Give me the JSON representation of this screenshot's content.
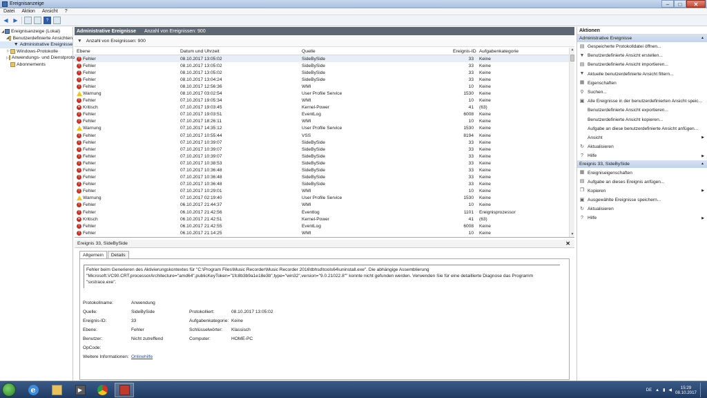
{
  "window": {
    "title": "Ereignisanzeige"
  },
  "menu": [
    "Datei",
    "Aktion",
    "Ansicht",
    "?"
  ],
  "tree": [
    {
      "label": "Ereignisanzeige (Lokal)",
      "level": 0,
      "icon": "computer-icon"
    },
    {
      "label": "Benutzerdefinierte Ansichten",
      "level": 1,
      "icon": "folder-icon"
    },
    {
      "label": "Administrative Ereignisse",
      "level": 2,
      "icon": "filter-icon",
      "selected": true
    },
    {
      "label": "Windows-Protokolle",
      "level": 1,
      "icon": "folder-icon"
    },
    {
      "label": "Anwendungs- und Dienstprotokolle",
      "level": 1,
      "icon": "folder-icon"
    },
    {
      "label": "Abonnements",
      "level": 1,
      "icon": "subscription-icon"
    }
  ],
  "center": {
    "title": "Administrative Ereignisse",
    "count_label": "Anzahl von Ereignissen: 900",
    "filter_label": "Anzahl von Ereignissen: 900",
    "columns": {
      "level": "Ebene",
      "date": "Datum und Uhrzeit",
      "source": "Quelle",
      "id": "Ereignis-ID",
      "category": "Aufgabenkategorie"
    }
  },
  "events": [
    {
      "type": "err",
      "level": "Fehler",
      "date": "08.10.2017 13:05:02",
      "source": "SideBySide",
      "id": "33",
      "cat": "Keine"
    },
    {
      "type": "err",
      "level": "Fehler",
      "date": "08.10.2017 13:05:02",
      "source": "SideBySide",
      "id": "33",
      "cat": "Keine"
    },
    {
      "type": "err",
      "level": "Fehler",
      "date": "08.10.2017 13:05:02",
      "source": "SideBySide",
      "id": "33",
      "cat": "Keine"
    },
    {
      "type": "err",
      "level": "Fehler",
      "date": "08.10.2017 13:04:24",
      "source": "SideBySide",
      "id": "33",
      "cat": "Keine"
    },
    {
      "type": "err",
      "level": "Fehler",
      "date": "08.10.2017 12:56:36",
      "source": "WMI",
      "id": "10",
      "cat": "Keine"
    },
    {
      "type": "warn",
      "level": "Warnung",
      "date": "08.10.2017 03:02:54",
      "source": "User Profile Service",
      "id": "1530",
      "cat": "Keine"
    },
    {
      "type": "err",
      "level": "Fehler",
      "date": "07.10.2017 19:05:34",
      "source": "WMI",
      "id": "10",
      "cat": "Keine"
    },
    {
      "type": "crit",
      "level": "Kritisch",
      "date": "07.10.2017 19:03:45",
      "source": "Kernel-Power",
      "id": "41",
      "cat": "(63)"
    },
    {
      "type": "err",
      "level": "Fehler",
      "date": "07.10.2017 19:03:51",
      "source": "EventLog",
      "id": "6008",
      "cat": "Keine"
    },
    {
      "type": "err",
      "level": "Fehler",
      "date": "07.10.2017 18:26:11",
      "source": "WMI",
      "id": "10",
      "cat": "Keine"
    },
    {
      "type": "warn",
      "level": "Warnung",
      "date": "07.10.2017 14:35:12",
      "source": "User Profile Service",
      "id": "1530",
      "cat": "Keine"
    },
    {
      "type": "err",
      "level": "Fehler",
      "date": "07.10.2017 10:55:44",
      "source": "VSS",
      "id": "8194",
      "cat": "Keine"
    },
    {
      "type": "err",
      "level": "Fehler",
      "date": "07.10.2017 10:39:07",
      "source": "SideBySide",
      "id": "33",
      "cat": "Keine"
    },
    {
      "type": "err",
      "level": "Fehler",
      "date": "07.10.2017 10:39:07",
      "source": "SideBySide",
      "id": "33",
      "cat": "Keine"
    },
    {
      "type": "err",
      "level": "Fehler",
      "date": "07.10.2017 10:39:07",
      "source": "SideBySide",
      "id": "33",
      "cat": "Keine"
    },
    {
      "type": "err",
      "level": "Fehler",
      "date": "07.10.2017 10:38:53",
      "source": "SideBySide",
      "id": "33",
      "cat": "Keine"
    },
    {
      "type": "err",
      "level": "Fehler",
      "date": "07.10.2017 10:36:48",
      "source": "SideBySide",
      "id": "33",
      "cat": "Keine"
    },
    {
      "type": "err",
      "level": "Fehler",
      "date": "07.10.2017 10:36:48",
      "source": "SideBySide",
      "id": "33",
      "cat": "Keine"
    },
    {
      "type": "err",
      "level": "Fehler",
      "date": "07.10.2017 10:36:48",
      "source": "SideBySide",
      "id": "33",
      "cat": "Keine"
    },
    {
      "type": "err",
      "level": "Fehler",
      "date": "07.10.2017 10:29:01",
      "source": "WMI",
      "id": "10",
      "cat": "Keine"
    },
    {
      "type": "warn",
      "level": "Warnung",
      "date": "07.10.2017 02:19:40",
      "source": "User Profile Service",
      "id": "1530",
      "cat": "Keine"
    },
    {
      "type": "err",
      "level": "Fehler",
      "date": "06.10.2017 21:44:37",
      "source": "WMI",
      "id": "10",
      "cat": "Keine"
    },
    {
      "type": "err",
      "level": "Fehler",
      "date": "06.10.2017 21:42:56",
      "source": "Eventlog",
      "id": "1101",
      "cat": "Ereignisprozessor"
    },
    {
      "type": "crit",
      "level": "Kritisch",
      "date": "06.10.2017 21:42:51",
      "source": "Kernel-Power",
      "id": "41",
      "cat": "(63)"
    },
    {
      "type": "err",
      "level": "Fehler",
      "date": "06.10.2017 21:42:55",
      "source": "EventLog",
      "id": "6008",
      "cat": "Keine"
    },
    {
      "type": "err",
      "level": "Fehler",
      "date": "06.10.2017 21:14:25",
      "source": "WMI",
      "id": "10",
      "cat": "Keine"
    }
  ],
  "detail": {
    "header": "Ereignis 33, SideBySide",
    "tabs": [
      "Allgemein",
      "Details"
    ],
    "message_line1": "Fehler beim Generieren des Aktivierungskontextes für \"C:\\Program Files\\Music Recorder\\Music Recorder 2016\\tbhsd\\tools64\\uninstall.exe\". Die abhängige Assemblierung",
    "message_line2": "\"Microsoft.VC90.CRT,processorArchitecture=\"amd64\",publicKeyToken=\"1fc8b3b9a1e18e3b\",type=\"win32\",version=\"9.0.21022.8\"\" konnte nicht gefunden werden. Verwenden Sie für eine detaillierte Diagnose das Programm \"sxstrace.exe\".",
    "labels": {
      "log": "Protokollname:",
      "source": "Quelle:",
      "id": "Ereignis-ID:",
      "level": "Ebene:",
      "user": "Benutzer:",
      "opcode": "OpCode:",
      "more": "Weitere Informationen:",
      "logged": "Protokolliert:",
      "category": "Aufgabenkategorie:",
      "keywords": "Schlüsselwörter:",
      "computer": "Computer:"
    },
    "values": {
      "log": "Anwendung",
      "source": "SideBySide",
      "id": "33",
      "level": "Fehler",
      "user": "Nicht zutreffend",
      "more": "Onlinehilfe",
      "logged": "08.10.2017 13:05:02",
      "category": "Keine",
      "keywords": "Klassisch",
      "computer": "HOME-PC"
    }
  },
  "actions": {
    "header": "Aktionen",
    "section1": "Administrative Ereignisse",
    "items1": [
      {
        "label": "Gespeicherte Protokolldatei öffnen...",
        "icon": "open-log-icon"
      },
      {
        "label": "Benutzerdefinierte Ansicht erstellen...",
        "icon": "create-view-icon"
      },
      {
        "label": "Benutzerdefinierte Ansicht importieren...",
        "icon": "import-view-icon"
      },
      {
        "label": "Aktuelle benutzerdefinierte Ansicht filtern...",
        "icon": "filter-icon"
      },
      {
        "label": "Eigenschaften",
        "icon": "properties-icon"
      },
      {
        "label": "Suchen...",
        "icon": "find-icon"
      },
      {
        "label": "Alle Ereignisse in der benutzerdefinierten Ansicht speic...",
        "icon": "save-icon"
      },
      {
        "label": "Benutzerdefinierte Ansicht exportieren...",
        "icon": "none"
      },
      {
        "label": "Benutzerdefinierte Ansicht kopieren...",
        "icon": "none"
      },
      {
        "label": "Aufgabe an diese benutzerdefinierte Ansicht anfügen...",
        "icon": "none"
      },
      {
        "label": "Ansicht",
        "icon": "none",
        "submenu": true
      },
      {
        "label": "Aktualisieren",
        "icon": "refresh-icon"
      },
      {
        "label": "Hilfe",
        "icon": "help-icon",
        "submenu": true
      }
    ],
    "section2": "Ereignis 33, SideBySide",
    "items2": [
      {
        "label": "Ereigniseigenschaften",
        "icon": "event-properties-icon"
      },
      {
        "label": "Aufgabe an dieses Ereignis anfügen...",
        "icon": "attach-task-icon"
      },
      {
        "label": "Kopieren",
        "icon": "copy-icon",
        "submenu": true
      },
      {
        "label": "Ausgewählte Ereignisse speichern...",
        "icon": "save-icon"
      },
      {
        "label": "Aktualisieren",
        "icon": "refresh-icon"
      },
      {
        "label": "Hilfe",
        "icon": "help-icon",
        "submenu": true
      }
    ]
  },
  "taskbar": {
    "lang": "DE",
    "time": "15:29",
    "date": "08.10.2017"
  }
}
